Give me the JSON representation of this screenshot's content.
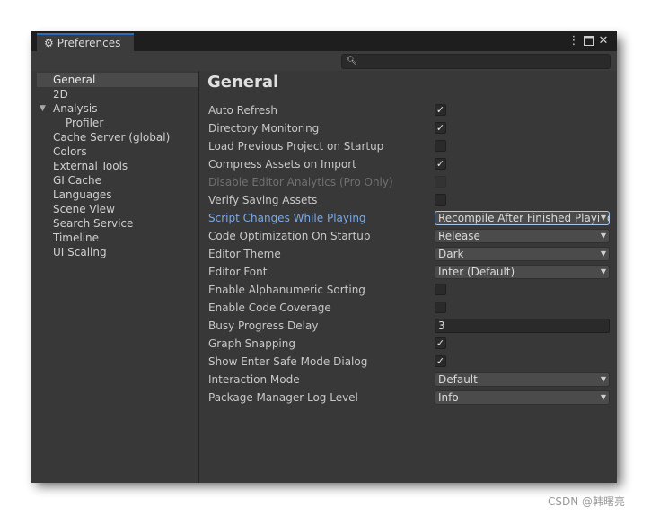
{
  "window": {
    "tab_title": "Preferences",
    "search_placeholder": ""
  },
  "sidebar": {
    "items": [
      {
        "label": "General",
        "selected": true
      },
      {
        "label": "2D"
      },
      {
        "label": "Analysis",
        "expanded": true
      },
      {
        "label": "Profiler",
        "indent": 1
      },
      {
        "label": "Cache Server (global)"
      },
      {
        "label": "Colors"
      },
      {
        "label": "External Tools"
      },
      {
        "label": "GI Cache"
      },
      {
        "label": "Languages"
      },
      {
        "label": "Scene View"
      },
      {
        "label": "Search Service"
      },
      {
        "label": "Timeline"
      },
      {
        "label": "UI Scaling"
      }
    ]
  },
  "main": {
    "title": "General",
    "rows": [
      {
        "label": "Auto Refresh",
        "type": "checkbox",
        "checked": true
      },
      {
        "label": "Directory Monitoring",
        "type": "checkbox",
        "checked": true
      },
      {
        "label": "Load Previous Project on Startup",
        "type": "checkbox",
        "checked": false
      },
      {
        "label": "Compress Assets on Import",
        "type": "checkbox",
        "checked": true
      },
      {
        "label": "Disable Editor Analytics (Pro Only)",
        "type": "checkbox",
        "checked": false,
        "disabled": true
      },
      {
        "label": "Verify Saving Assets",
        "type": "checkbox",
        "checked": false
      },
      {
        "label": "Script Changes While Playing",
        "type": "dropdown",
        "value": "Recompile After Finished Playing",
        "highlighted": true
      },
      {
        "label": "Code Optimization On Startup",
        "type": "dropdown",
        "value": "Release"
      },
      {
        "label": "Editor Theme",
        "type": "dropdown",
        "value": "Dark"
      },
      {
        "label": "Editor Font",
        "type": "dropdown",
        "value": "Inter (Default)"
      },
      {
        "label": "Enable Alphanumeric Sorting",
        "type": "checkbox",
        "checked": false
      },
      {
        "label": "Enable Code Coverage",
        "type": "checkbox",
        "checked": false
      },
      {
        "label": "Busy Progress Delay",
        "type": "number",
        "value": "3"
      },
      {
        "label": "Graph Snapping",
        "type": "checkbox",
        "checked": true
      },
      {
        "label": "Show Enter Safe Mode Dialog",
        "type": "checkbox",
        "checked": true
      },
      {
        "label": "Interaction Mode",
        "type": "dropdown",
        "value": "Default"
      },
      {
        "label": "Package Manager Log Level",
        "type": "dropdown",
        "value": "Info"
      }
    ]
  },
  "watermark": "CSDN @韩曙亮",
  "icons": {
    "tab": "gear-icon",
    "menu": "kebab-menu-icon",
    "maximize": "maximize-icon",
    "close": "close-icon",
    "search": "search-icon",
    "expand": "triangle-down-icon",
    "check": "check-icon",
    "dropdown": "chevron-down-icon"
  },
  "colors": {
    "background": "#383838",
    "titlebar": "#1e1e1e",
    "tab_accent": "#2d6bb7",
    "selection": "#4a4a4a",
    "highlight_label": "#7ea8e0"
  }
}
